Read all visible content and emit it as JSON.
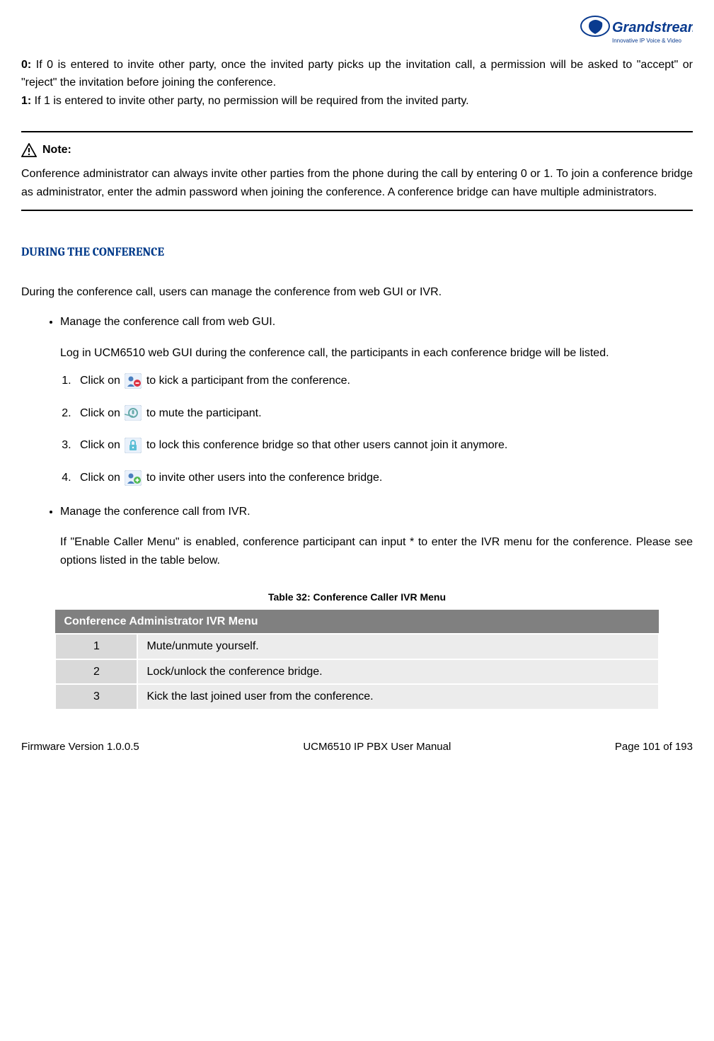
{
  "logo": {
    "brand": "Grandstream",
    "tagline": "Innovative IP Voice & Video"
  },
  "intro": {
    "zero_label": "0:",
    "zero_text": " If 0 is entered to invite other party, once the invited party picks up the invitation call, a permission will be asked to \"accept\" or \"reject\" the invitation before joining the conference.",
    "one_label": "1:",
    "one_text": " If 1 is entered to invite other party, no permission will be required from the invited party."
  },
  "note": {
    "label": "Note:",
    "text": "Conference administrator can always invite other parties from the phone during the call by entering 0 or 1. To join a conference bridge as administrator, enter the admin password when joining the conference. A conference bridge can have multiple administrators."
  },
  "section_heading": "DURING THE CONFERENCE",
  "section_intro": "During the conference call, users can manage the conference from web GUI or IVR.",
  "bullets": {
    "web": {
      "title": "Manage the conference call from web GUI.",
      "desc": "Log in UCM6510 web GUI during the conference call, the participants in each conference bridge will be listed.",
      "steps": {
        "s1a": "Click on ",
        "s1b": " to kick a participant from the conference.",
        "s2a": "Click on ",
        "s2b": " to mute the participant.",
        "s3a": "Click on ",
        "s3b": " to lock this conference bridge so that other users cannot join it anymore.",
        "s4a": "Click on ",
        "s4b": " to invite other users into the conference bridge."
      }
    },
    "ivr": {
      "title": "Manage the conference call from IVR.",
      "desc": "If \"Enable Caller Menu\" is enabled, conference participant can input * to enter the IVR menu for the conference. Please see options listed in the table below."
    }
  },
  "table": {
    "caption": "Table 32: Conference Caller IVR Menu",
    "header": "Conference Administrator IVR Menu",
    "rows": [
      {
        "key": "1",
        "desc": "Mute/unmute yourself."
      },
      {
        "key": "2",
        "desc": "Lock/unlock the conference bridge."
      },
      {
        "key": "3",
        "desc": "Kick the last joined user from the conference."
      }
    ]
  },
  "footer": {
    "left": "Firmware Version 1.0.0.5",
    "center": "UCM6510 IP PBX User Manual",
    "right": "Page 101 of 193"
  }
}
